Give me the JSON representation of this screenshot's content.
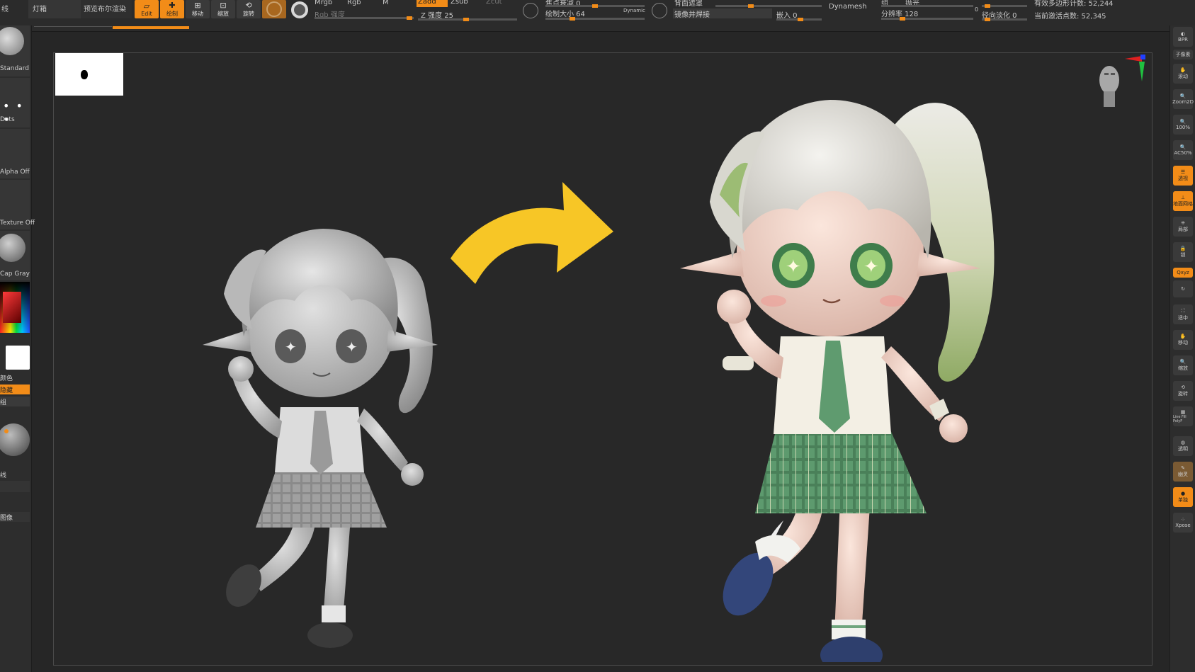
{
  "topbar": {
    "left_label_1": "线",
    "left_label_2": "灯箱",
    "preview_render": "预览布尔渲染",
    "edit_label": "Edit",
    "draw_label": "绘制",
    "move_label": "移动",
    "scale_label": "缩放",
    "rotate_label": "旋转",
    "mrgb": "Mrgb",
    "rgb": "Rgb",
    "m": "M",
    "rgb_strength": "Rgb 强度",
    "zadd": "Zadd",
    "zsub": "Zsub",
    "zcut": "Zcut",
    "z_intensity": "Z 强度 25",
    "focal_shift": "焦点衰减 0",
    "draw_size": "绘制大小 64",
    "dynamic": "Dynamic",
    "backface": "背面遮罩",
    "mirror_weld": "镜像并焊接",
    "dynamesh": "Dynamesh",
    "group": "组",
    "polish": "抛光",
    "resolution": "分辨率 128",
    "embed": "嵌入 0",
    "radial_fade": "径向淡化 0",
    "active_points": "当前激活点数: 52,345",
    "total_points": "有效多边形计数: 52,244",
    "tilde_val": "0"
  },
  "left_panel": {
    "brush_label": "Standard",
    "stroke_label": "Dots",
    "alpha_label": "Alpha Off",
    "texture_label": "Texture Off",
    "material_label": "Cap Gray",
    "color_label": "颜色",
    "hide_label": "隐藏",
    "group_label": "组",
    "line_label": "线",
    "image_label": "图像"
  },
  "right_panel": {
    "bpr": "BPR",
    "subpixel": "子像素",
    "scroll": "滚动",
    "zoom2d": "Zoom2D",
    "zoom100": "100%",
    "ac50": "AC50%",
    "persp": "透视",
    "floor": "地面网格",
    "local": "局部",
    "lock": "锁",
    "xyz": "Qxyz",
    "frame": "适中",
    "move": "移动",
    "zoom3d": "缩放",
    "rotate": "旋转",
    "linefill": "Line Fill PolyF",
    "transp": "透明",
    "ghost": "幽灵",
    "solo": "单独",
    "xpose": "Xpose"
  },
  "colors": {
    "accent": "#f28c18",
    "arrow": "#f7c626",
    "canvas_bg": "#282828"
  }
}
